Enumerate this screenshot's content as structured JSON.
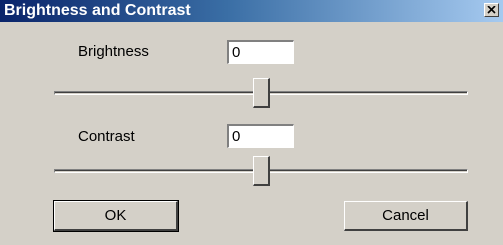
{
  "dialog": {
    "title": "Brightness and Contrast",
    "close_icon": "close-icon"
  },
  "brightness": {
    "label": "Brightness",
    "value": "0",
    "slider_position": 0.5
  },
  "contrast": {
    "label": "Contrast",
    "value": "0",
    "slider_position": 0.5
  },
  "buttons": {
    "ok_label": "OK",
    "cancel_label": "Cancel"
  },
  "colors": {
    "window_face": "#d4d0c8",
    "titlebar_start": "#0a246a",
    "titlebar_end": "#a6caf0",
    "title_text": "#ffffff"
  }
}
